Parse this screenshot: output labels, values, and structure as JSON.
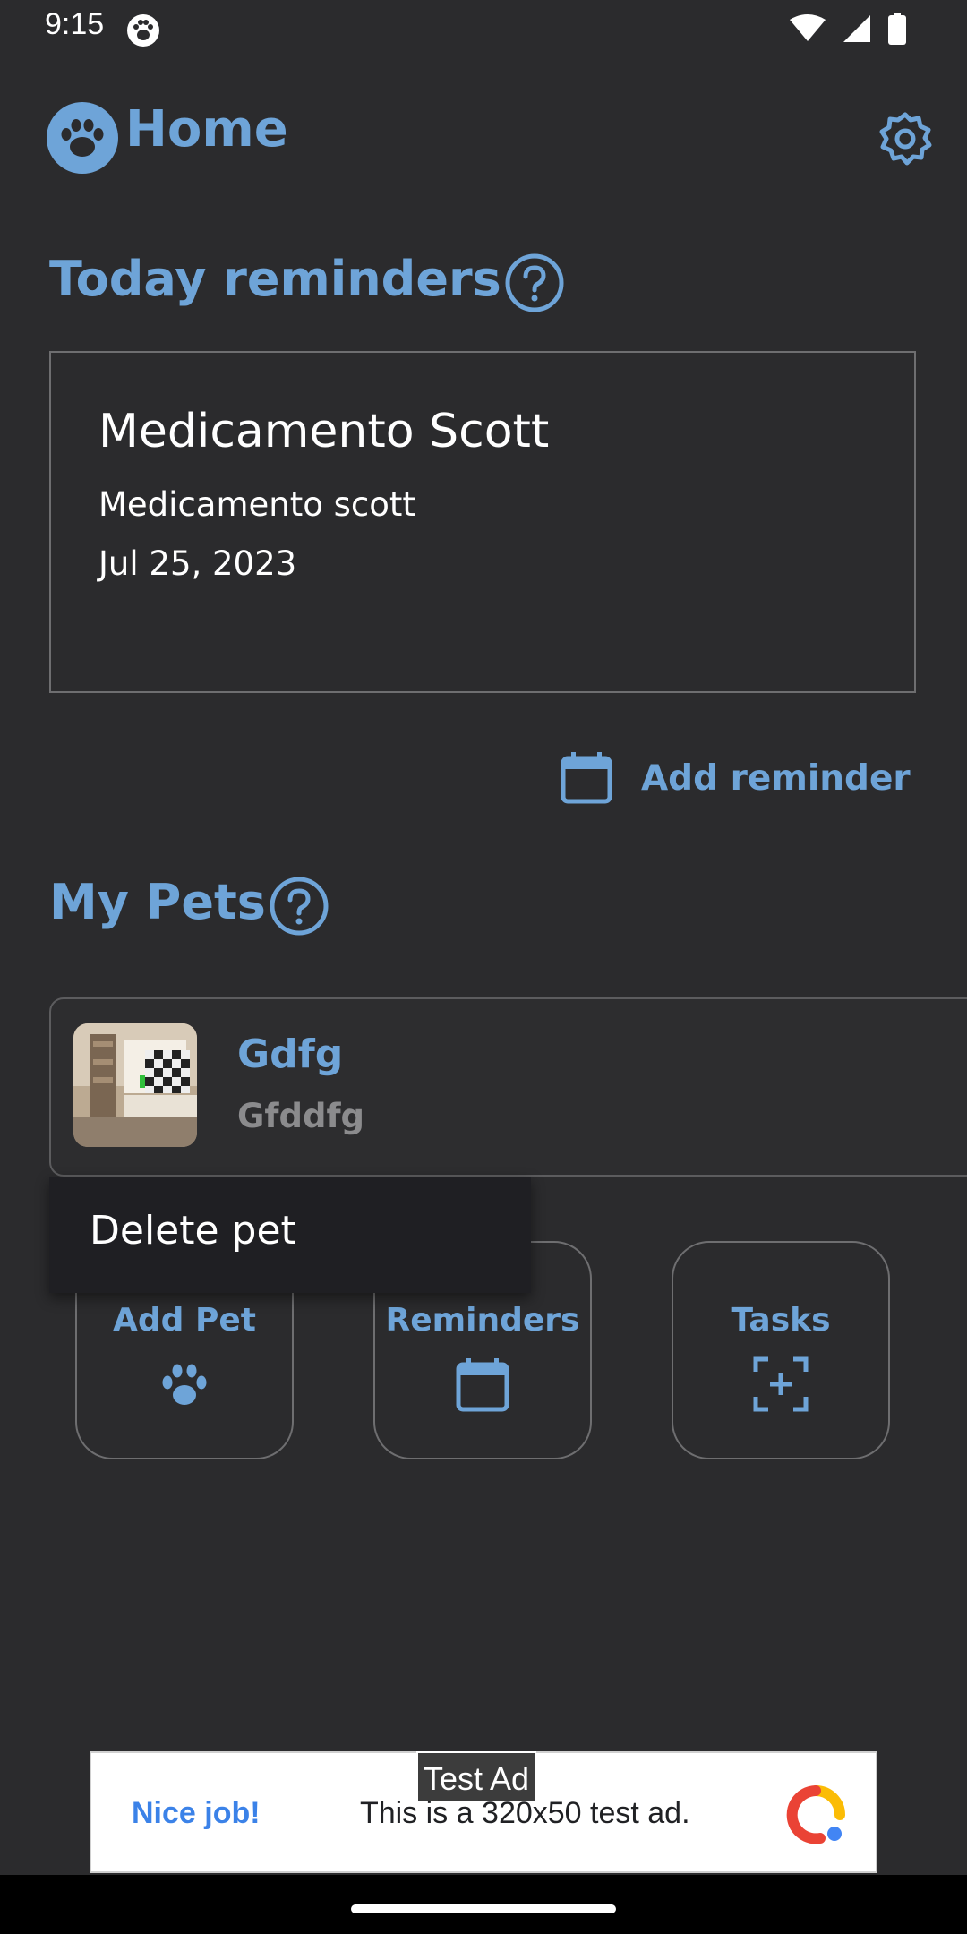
{
  "status_bar": {
    "time": "9:15"
  },
  "header": {
    "title": "Home"
  },
  "reminders_section": {
    "title": "Today reminders",
    "card": {
      "title": "Medicamento Scott",
      "subtitle": "Medicamento scott",
      "date": "Jul 25, 2023"
    },
    "add_label": "Add reminder"
  },
  "pets_section": {
    "title": "My Pets",
    "pet": {
      "name": "Gdfg",
      "description": "Gfddfg"
    }
  },
  "actions": [
    {
      "label": "Add Pet",
      "icon": "paw-icon"
    },
    {
      "label": "Reminders",
      "icon": "calendar-icon"
    },
    {
      "label": "Tasks",
      "icon": "add-task-icon"
    }
  ],
  "popup_menu": {
    "items": [
      "Delete pet"
    ]
  },
  "ad": {
    "badge": "Test Ad",
    "headline": "Nice job!",
    "text": "This is a 320x50 test ad."
  },
  "colors": {
    "background": "#2b2b2d",
    "accent": "#6ea4d8",
    "popup": "#1f1f23"
  }
}
